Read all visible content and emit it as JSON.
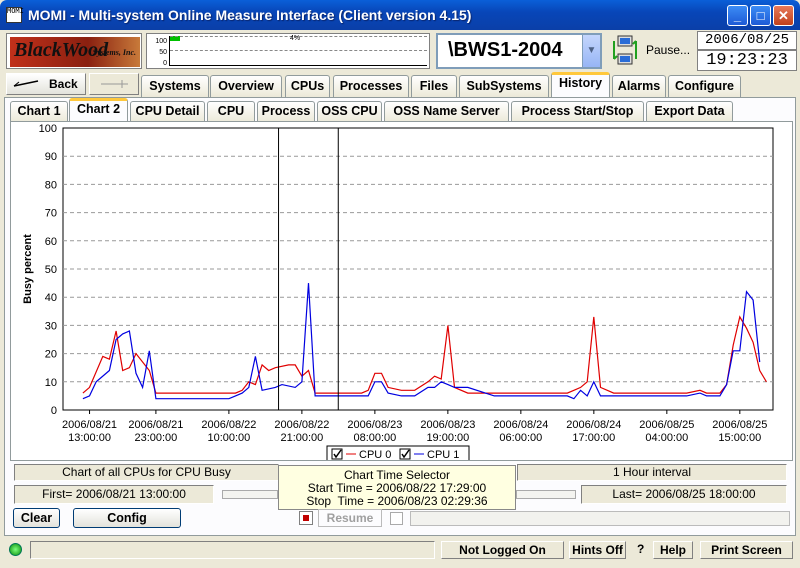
{
  "window": {
    "title": "MOMI - Multi-system Online Measure Interface (Client version 4.15)",
    "icon_name": "momi-app-icon",
    "icon_text": "MOMI"
  },
  "toolbar": {
    "logo_main": "BlackWood",
    "logo_sub": "Systems, Inc.",
    "meter_ticks": [
      "100",
      "50",
      "0"
    ],
    "meter_label": "4%",
    "system": "\\BWS1-2004",
    "pause_label": "Pause...",
    "date": "2006/08/25",
    "time": "19:23:23"
  },
  "nav": {
    "back_label": "Back",
    "forward_label": ""
  },
  "tabs": [
    "Systems",
    "Overview",
    "CPUs",
    "Processes",
    "Files",
    "SubSystems",
    "History",
    "Alarms",
    "Configure"
  ],
  "active_tab": "History",
  "subtabs": [
    "Chart 1",
    "Chart 2",
    "CPU Detail",
    "CPU",
    "Process",
    "OSS CPU",
    "OSS Name Server",
    "Process Start/Stop",
    "Export Data"
  ],
  "active_subtab": "Chart 2",
  "chart_data": {
    "type": "line",
    "ylabel": "Busy percent",
    "ylim": [
      0,
      100
    ],
    "yticks": [
      0,
      10,
      20,
      30,
      40,
      50,
      60,
      70,
      80,
      90,
      100
    ],
    "grid": true,
    "xlim": [
      "2006/08/21 09:00",
      "2006/08/25 20:00"
    ],
    "xticks": [
      {
        "date": "2006/08/21",
        "time": "13:00:00"
      },
      {
        "date": "2006/08/21",
        "time": "23:00:00"
      },
      {
        "date": "2006/08/22",
        "time": "10:00:00"
      },
      {
        "date": "2006/08/22",
        "time": "21:00:00"
      },
      {
        "date": "2006/08/23",
        "time": "08:00:00"
      },
      {
        "date": "2006/08/23",
        "time": "19:00:00"
      },
      {
        "date": "2006/08/24",
        "time": "06:00:00"
      },
      {
        "date": "2006/08/24",
        "time": "17:00:00"
      },
      {
        "date": "2006/08/25",
        "time": "04:00:00"
      },
      {
        "date": "2006/08/25",
        "time": "15:00:00"
      }
    ],
    "selection": [
      "2006/08/22 17:29",
      "2006/08/23 02:29"
    ],
    "legend_placement": "bottom-center",
    "series": [
      {
        "name": "CPU 0",
        "color": "#e00000",
        "points": [
          [
            "2006/08/21 12:00",
            6
          ],
          [
            "2006/08/21 13:00",
            8
          ],
          [
            "2006/08/21 15:00",
            19
          ],
          [
            "2006/08/21 16:00",
            18
          ],
          [
            "2006/08/21 17:00",
            28
          ],
          [
            "2006/08/21 18:00",
            14
          ],
          [
            "2006/08/21 19:00",
            15
          ],
          [
            "2006/08/21 20:00",
            20
          ],
          [
            "2006/08/21 22:00",
            14
          ],
          [
            "2006/08/21 23:00",
            6
          ],
          [
            "2006/08/22 02:00",
            6
          ],
          [
            "2006/08/22 06:00",
            6
          ],
          [
            "2006/08/22 09:00",
            6
          ],
          [
            "2006/08/22 11:00",
            6
          ],
          [
            "2006/08/22 12:00",
            7
          ],
          [
            "2006/08/22 13:00",
            10
          ],
          [
            "2006/08/22 14:00",
            9
          ],
          [
            "2006/08/22 15:00",
            16
          ],
          [
            "2006/08/22 16:00",
            14
          ],
          [
            "2006/08/22 17:00",
            15
          ],
          [
            "2006/08/22 19:00",
            16
          ],
          [
            "2006/08/22 20:00",
            16
          ],
          [
            "2006/08/22 21:00",
            12
          ],
          [
            "2006/08/22 22:00",
            14
          ],
          [
            "2006/08/22 23:00",
            6
          ],
          [
            "2006/08/23 02:00",
            6
          ],
          [
            "2006/08/23 06:00",
            6
          ],
          [
            "2006/08/23 07:00",
            7
          ],
          [
            "2006/08/23 08:00",
            13
          ],
          [
            "2006/08/23 09:00",
            13
          ],
          [
            "2006/08/23 10:00",
            8
          ],
          [
            "2006/08/23 12:00",
            7
          ],
          [
            "2006/08/23 14:00",
            7
          ],
          [
            "2006/08/23 16:00",
            10
          ],
          [
            "2006/08/23 17:00",
            12
          ],
          [
            "2006/08/23 18:00",
            11
          ],
          [
            "2006/08/23 19:00",
            30
          ],
          [
            "2006/08/23 20:00",
            8
          ],
          [
            "2006/08/23 22:00",
            6
          ],
          [
            "2006/08/24 02:00",
            6
          ],
          [
            "2006/08/24 06:00",
            6
          ],
          [
            "2006/08/24 10:00",
            6
          ],
          [
            "2006/08/24 13:00",
            6
          ],
          [
            "2006/08/24 14:00",
            7
          ],
          [
            "2006/08/24 15:00",
            8
          ],
          [
            "2006/08/24 16:00",
            10
          ],
          [
            "2006/08/24 17:00",
            33
          ],
          [
            "2006/08/24 18:00",
            8
          ],
          [
            "2006/08/24 20:00",
            6
          ],
          [
            "2006/08/25 00:00",
            6
          ],
          [
            "2006/08/25 04:00",
            6
          ],
          [
            "2006/08/25 07:00",
            6
          ],
          [
            "2006/08/25 09:00",
            7
          ],
          [
            "2006/08/25 10:00",
            6
          ],
          [
            "2006/08/25 12:00",
            6
          ],
          [
            "2006/08/25 13:00",
            9
          ],
          [
            "2006/08/25 14:00",
            23
          ],
          [
            "2006/08/25 15:00",
            33
          ],
          [
            "2006/08/25 16:00",
            29
          ],
          [
            "2006/08/25 17:00",
            24
          ],
          [
            "2006/08/25 18:00",
            14
          ],
          [
            "2006/08/25 19:00",
            10
          ]
        ]
      },
      {
        "name": "CPU 1",
        "color": "#0000e0",
        "points": [
          [
            "2006/08/21 12:00",
            4
          ],
          [
            "2006/08/21 13:00",
            5
          ],
          [
            "2006/08/21 14:00",
            10
          ],
          [
            "2006/08/21 16:00",
            14
          ],
          [
            "2006/08/21 17:00",
            25
          ],
          [
            "2006/08/21 18:00",
            27
          ],
          [
            "2006/08/21 19:00",
            28
          ],
          [
            "2006/08/21 20:00",
            13
          ],
          [
            "2006/08/21 21:00",
            8
          ],
          [
            "2006/08/21 22:00",
            21
          ],
          [
            "2006/08/21 23:00",
            4
          ],
          [
            "2006/08/22 02:00",
            4
          ],
          [
            "2006/08/22 06:00",
            4
          ],
          [
            "2006/08/22 10:00",
            4
          ],
          [
            "2006/08/22 11:00",
            5
          ],
          [
            "2006/08/22 12:00",
            6
          ],
          [
            "2006/08/22 13:00",
            8
          ],
          [
            "2006/08/22 14:00",
            19
          ],
          [
            "2006/08/22 15:00",
            7
          ],
          [
            "2006/08/22 17:00",
            8
          ],
          [
            "2006/08/22 18:00",
            9
          ],
          [
            "2006/08/22 20:00",
            8
          ],
          [
            "2006/08/22 21:00",
            10
          ],
          [
            "2006/08/22 22:00",
            45
          ],
          [
            "2006/08/22 23:00",
            5
          ],
          [
            "2006/08/23 02:00",
            5
          ],
          [
            "2006/08/23 06:00",
            5
          ],
          [
            "2006/08/23 07:00",
            5
          ],
          [
            "2006/08/23 08:00",
            10
          ],
          [
            "2006/08/23 09:00",
            10
          ],
          [
            "2006/08/23 10:00",
            6
          ],
          [
            "2006/08/23 12:00",
            5
          ],
          [
            "2006/08/23 14:00",
            5
          ],
          [
            "2006/08/23 16:00",
            8
          ],
          [
            "2006/08/23 17:00",
            8
          ],
          [
            "2006/08/23 18:00",
            10
          ],
          [
            "2006/08/23 19:00",
            9
          ],
          [
            "2006/08/23 20:00",
            8
          ],
          [
            "2006/08/23 22:00",
            8
          ],
          [
            "2006/08/24 02:00",
            5
          ],
          [
            "2006/08/24 06:00",
            5
          ],
          [
            "2006/08/24 10:00",
            5
          ],
          [
            "2006/08/24 13:00",
            5
          ],
          [
            "2006/08/24 14:00",
            4
          ],
          [
            "2006/08/24 15:00",
            7
          ],
          [
            "2006/08/24 16:00",
            5
          ],
          [
            "2006/08/24 17:00",
            10
          ],
          [
            "2006/08/24 18:00",
            5
          ],
          [
            "2006/08/24 20:00",
            5
          ],
          [
            "2006/08/25 00:00",
            5
          ],
          [
            "2006/08/25 04:00",
            5
          ],
          [
            "2006/08/25 07:00",
            5
          ],
          [
            "2006/08/25 09:00",
            6
          ],
          [
            "2006/08/25 10:00",
            5
          ],
          [
            "2006/08/25 12:00",
            5
          ],
          [
            "2006/08/25 13:00",
            9
          ],
          [
            "2006/08/25 14:00",
            21
          ],
          [
            "2006/08/25 15:00",
            21
          ],
          [
            "2006/08/25 16:00",
            42
          ],
          [
            "2006/08/25 17:00",
            39
          ],
          [
            "2006/08/25 18:00",
            17
          ]
        ]
      }
    ]
  },
  "footer": {
    "chart_description": "Chart of all CPUs for CPU Busy",
    "interval": "1 Hour interval",
    "first": "First= 2006/08/21 13:00:00",
    "last": "Last= 2006/08/25 18:00:00",
    "selector_title": "Chart Time Selector",
    "selector_start": "Start Time = 2006/08/22 17:29:00",
    "selector_stop": "Stop  Time = 2006/08/23 02:29:36",
    "clear_label": "Clear",
    "config_label": "Config",
    "resume_label": "Resume"
  },
  "status": {
    "login": "Not Logged On",
    "hints": "Hints Off",
    "question": "?",
    "help": "Help",
    "print": "Print Screen"
  }
}
